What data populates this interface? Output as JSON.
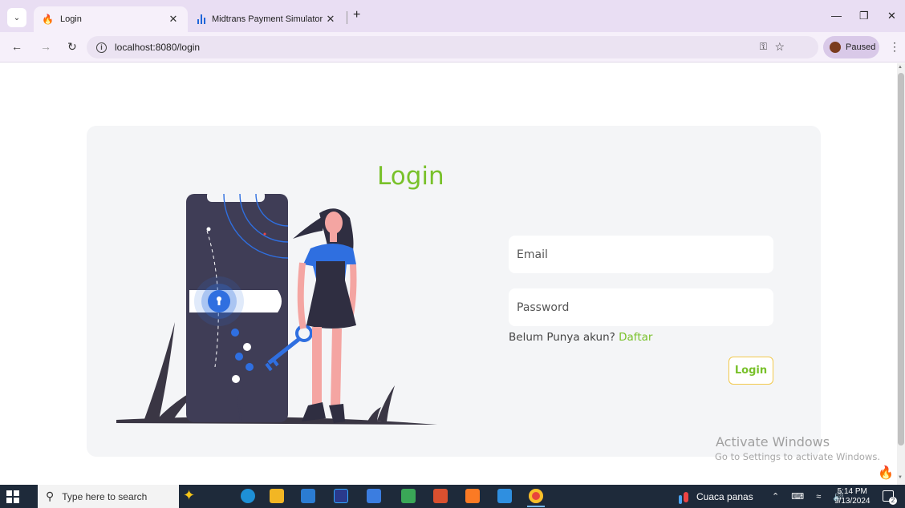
{
  "browser": {
    "tabs": [
      {
        "title": "Login",
        "icon": "fire-icon",
        "active": true
      },
      {
        "title": "Midtrans Payment Simulator",
        "icon": "midtrans-icon",
        "active": false
      }
    ],
    "new_tab": "+",
    "url": "localhost:8080/login",
    "profile": {
      "initial": "r",
      "status": "Paused"
    }
  },
  "page": {
    "title": "Login",
    "email_placeholder": "Email",
    "password_placeholder": "Password",
    "signup_prompt": "Belum Punya akun?",
    "signup_link": "Daftar",
    "login_button": "Login"
  },
  "watermark": {
    "line1": "Activate Windows",
    "line2": "Go to Settings to activate Windows."
  },
  "taskbar": {
    "search_placeholder": "Type here to search",
    "weather": "Cuaca panas",
    "time": "5:14 PM",
    "date": "9/13/2024",
    "notifications": "2"
  },
  "colors": {
    "accent": "#79c12b",
    "button_border": "#f2c94c",
    "card_bg": "#f4f5f7",
    "tabbar_bg": "#e9def3"
  }
}
